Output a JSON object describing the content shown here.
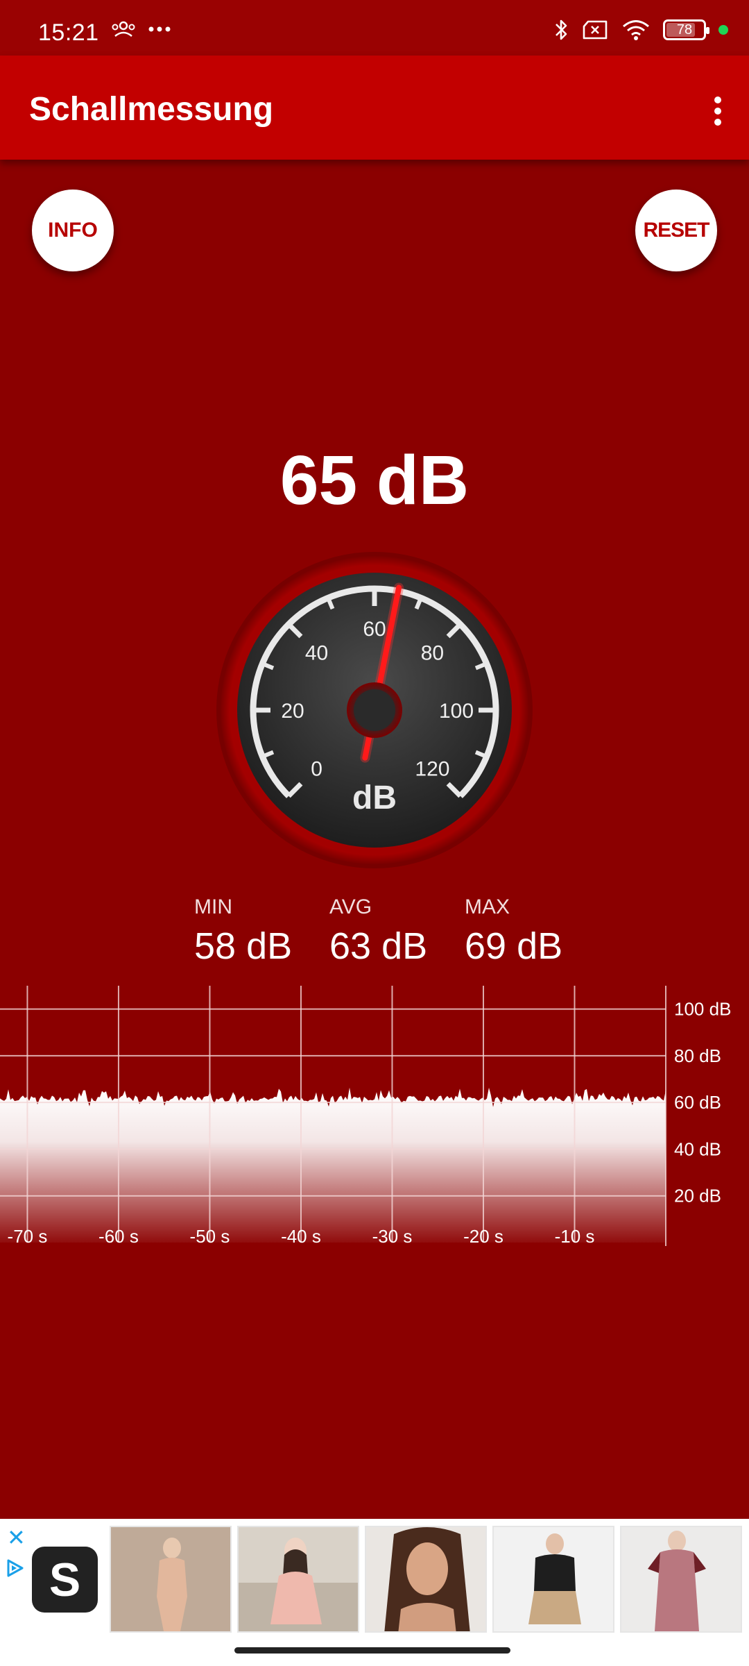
{
  "status": {
    "time": "15:21",
    "battery": "78"
  },
  "app": {
    "title": "Schallmessung"
  },
  "buttons": {
    "info": "INFO",
    "reset": "RESET"
  },
  "readout": {
    "current": "65 dB",
    "current_value": 65
  },
  "gauge": {
    "ticks": [
      "0",
      "20",
      "40",
      "60",
      "80",
      "100",
      "120"
    ],
    "unit": "dB",
    "min": 0,
    "max": 120,
    "needle_value": 65
  },
  "stats": {
    "min_label": "MIN",
    "min_value": "58 dB",
    "avg_label": "AVG",
    "avg_value": "63 dB",
    "max_label": "MAX",
    "max_value": "69 dB"
  },
  "chart_data": {
    "type": "area",
    "x_tick_labels": [
      "-70 s",
      "-60 s",
      "-50 s",
      "-40 s",
      "-30 s",
      "-20 s",
      "-10 s"
    ],
    "y_tick_labels": [
      "100 dB",
      "80 dB",
      "60 dB",
      "40 dB",
      "20 dB"
    ],
    "xlim": [
      -73,
      0
    ],
    "ylim": [
      0,
      110
    ],
    "y_ticks": [
      100,
      80,
      60,
      40,
      20
    ],
    "x_ticks": [
      -70,
      -60,
      -50,
      -40,
      -30,
      -20,
      -10
    ],
    "level_range_db": [
      58,
      69
    ],
    "grid": true
  },
  "ad": {
    "logo_letter": "S"
  },
  "colors": {
    "background": "#8b0000",
    "appbar": "#c20000",
    "accent": "#ff1a1a"
  }
}
